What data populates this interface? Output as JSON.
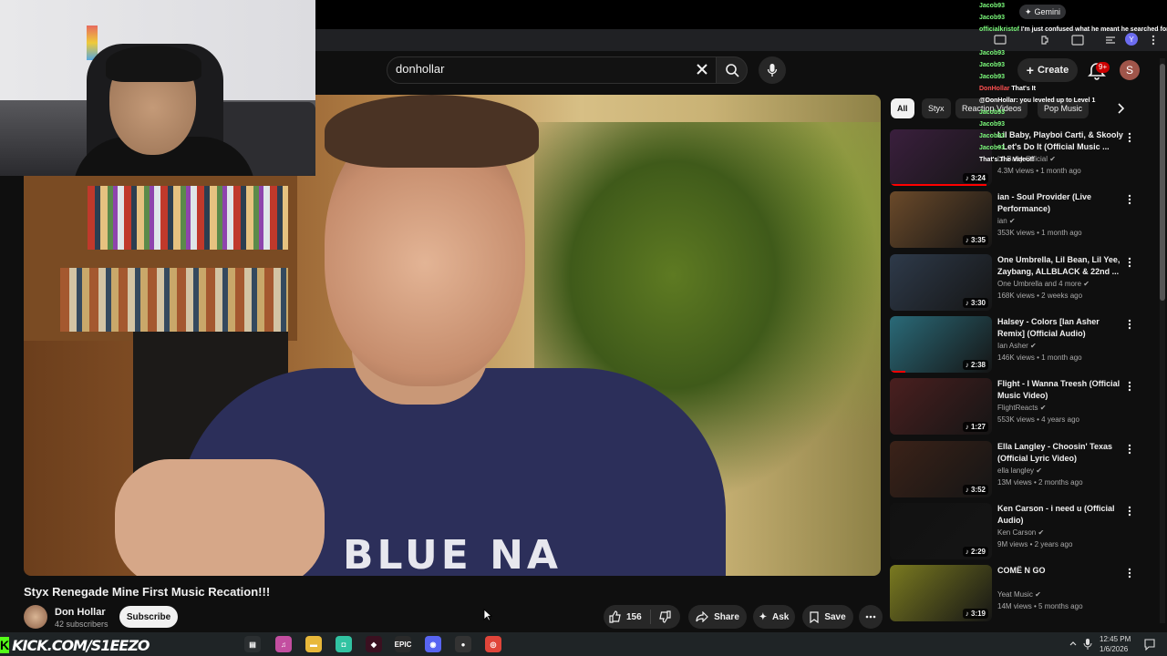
{
  "search": {
    "query": "donhollar"
  },
  "header": {
    "create_label": "Create",
    "notif_badge": "9+",
    "avatar_letter": "S"
  },
  "video": {
    "overlay_text": "BLUE NA",
    "title": "Styx Renegade Mine First Music Recation!!!",
    "channel": "Don Hollar",
    "subscribers": "42 subscribers",
    "subscribe_label": "Subscribe",
    "likes": "156",
    "share_label": "Share",
    "ask_label": "Ask",
    "save_label": "Save"
  },
  "chips": [
    "All",
    "Styx",
    "Reaction Videos",
    "Pop Music"
  ],
  "recommendations": [
    {
      "title": "Lil Baby, Playboi Carti, & Skooly - Let's Do It (Official Music ...",
      "channel": "Lil Baby Official",
      "meta": "4.3M views • 1 month ago",
      "duration": "3:24",
      "thumb": "#3a1f3d",
      "progress": 0.95
    },
    {
      "title": "ian - Soul Provider (Live Performance)",
      "channel": "ian",
      "meta": "353K views • 1 month ago",
      "duration": "3:35",
      "thumb": "#6b4a2a",
      "progress": 0.0
    },
    {
      "title": "One Umbrella, Lil Bean, Lil Yee, Zaybang, ALLBLACK & 22nd ...",
      "channel": "One Umbrella and 4 more",
      "meta": "168K views • 2 weeks ago",
      "duration": "3:30",
      "thumb": "#2e3a4a",
      "progress": 0.0
    },
    {
      "title": "Halsey - Colors [Ian Asher Remix] (Official Audio)",
      "channel": "Ian Asher",
      "meta": "146K views • 1 month ago",
      "duration": "2:38",
      "thumb": "#2a6a78",
      "progress": 0.15
    },
    {
      "title": "Flight - I Wanna Treesh (Official Music Video)",
      "channel": "FlightReacts",
      "meta": "553K views • 4 years ago",
      "duration": "1:27",
      "thumb": "#4a1f1f",
      "progress": 0.0
    },
    {
      "title": "Ella Langley - Choosin' Texas (Official Lyric Video)",
      "channel": "ella langley",
      "meta": "13M views • 2 months ago",
      "duration": "3:52",
      "thumb": "#3b2218",
      "progress": 0.0
    },
    {
      "title": "Ken Carson - i need u (Official Audio)",
      "channel": "Ken Carson",
      "meta": "9M views • 2 years ago",
      "duration": "2:29",
      "thumb": "#111111",
      "progress": 0.0
    },
    {
      "title": "COMË N GO",
      "channel": "Yeat Music",
      "meta": "14M views • 5 months ago",
      "duration": "3:19",
      "thumb": "#7a7a20",
      "progress": 0.0
    }
  ],
  "chat": [
    {
      "name": "Jacob93",
      "msg": "",
      "color": "green"
    },
    {
      "name": "Jacob93",
      "msg": "",
      "color": "green"
    },
    {
      "name": "officialkristof",
      "msg": "I'm just confused what he meant he searched for you lmao",
      "color": "green"
    },
    {
      "name": "",
      "msg": "",
      "color": "green"
    },
    {
      "name": "Jacob93",
      "msg": "",
      "color": "green"
    },
    {
      "name": "Jacob93",
      "msg": "",
      "color": "green"
    },
    {
      "name": "Jacob93",
      "msg": "",
      "color": "green"
    },
    {
      "name": "DonHollar",
      "msg": "That's It",
      "color": "red"
    },
    {
      "name": "",
      "msg": "@DonHollar: you leveled up to Level 1",
      "color": "green"
    },
    {
      "name": "Jacob93",
      "msg": "",
      "color": "green"
    },
    {
      "name": "Jacob93",
      "msg": "",
      "color": "green"
    },
    {
      "name": "Jacob93",
      "msg": "",
      "color": "green"
    },
    {
      "name": "Jacob93",
      "msg": "",
      "color": "green"
    },
    {
      "name": "",
      "msg": "That's The Video!!",
      "color": "green"
    }
  ],
  "gemini_label": "Gemini",
  "taskbar": {
    "kick_text": "KICK.COM/S1EEZO",
    "time": "12:45 PM",
    "date": "1/6/2026",
    "apps": [
      {
        "name": "task-view-icon",
        "glyph": "▤",
        "color": "#2b2f31"
      },
      {
        "name": "itunes-icon",
        "glyph": "♫",
        "color": "#c34ea0"
      },
      {
        "name": "file-explorer-icon",
        "glyph": "▬",
        "color": "#e8b83a"
      },
      {
        "name": "streamlabs-icon",
        "glyph": "◘",
        "color": "#31c3a2"
      },
      {
        "name": "davinci-icon",
        "glyph": "◆",
        "color": "#3a1020"
      },
      {
        "name": "epic-games-icon",
        "glyph": "EPIC",
        "color": "#2a2a2a"
      },
      {
        "name": "discord-icon",
        "glyph": "◉",
        "color": "#5865f2"
      },
      {
        "name": "obs-icon",
        "glyph": "●",
        "color": "#333333"
      },
      {
        "name": "chrome-icon",
        "glyph": "◎",
        "color": "#e0453a"
      }
    ]
  }
}
